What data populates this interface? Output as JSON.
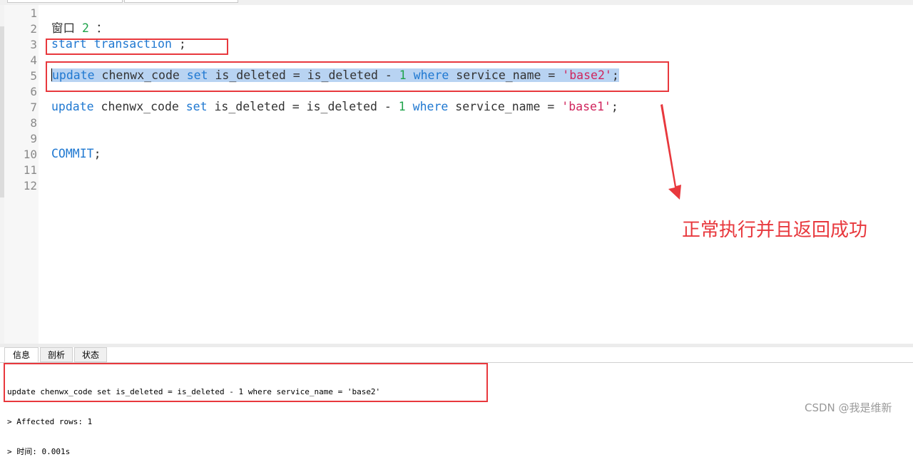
{
  "editor": {
    "line_numbers": [
      "1",
      "2",
      "3",
      "4",
      "5",
      "6",
      "7",
      "8",
      "9",
      "10",
      "11",
      "12"
    ],
    "lines": {
      "l2": {
        "text": "窗口",
        "num": "2",
        "punct": " ："
      },
      "l3": {
        "kw1": "start",
        "kw2": "transaction",
        "tail": " ;"
      },
      "l5": {
        "kw1": "update",
        "t1": " chenwx_code ",
        "kw2": "set",
        "t2": " is_deleted = is_deleted - ",
        "num": "1",
        "kw3": " where",
        "t3": " service_name = ",
        "str": "'base2'",
        "end": ";"
      },
      "l7": {
        "kw1": "update",
        "t1": " chenwx_code ",
        "kw2": "set",
        "t2": " is_deleted = is_deleted - ",
        "num": "1",
        "kw3": " where",
        "t3": " service_name = ",
        "str": "'base1'",
        "end": ";"
      },
      "l10": {
        "kw": "COMMIT",
        "end": ";"
      }
    }
  },
  "annotation": {
    "text": "正常执行并且返回成功"
  },
  "result_panel": {
    "tabs": [
      "信息",
      "剖析",
      "状态"
    ],
    "active_tab": "信息",
    "output_lines": [
      "update chenwx_code set is_deleted = is_deleted - 1 where service_name = 'base2'",
      "> Affected rows: 1",
      "> 时间: 0.001s"
    ]
  },
  "watermark": {
    "text": "CSDN @我是维新"
  },
  "colors": {
    "keyword": "#1f78d1",
    "number": "#1ea34a",
    "string": "#d0245c",
    "highlight_box": "#e8383d",
    "selection": "#b8d3f2"
  }
}
